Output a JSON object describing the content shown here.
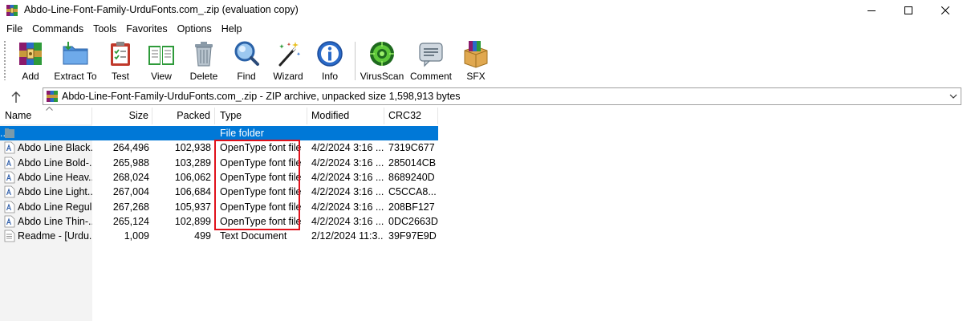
{
  "window": {
    "title": "Abdo-Line-Font-Family-UrduFonts.com_.zip (evaluation copy)"
  },
  "menu": [
    "File",
    "Commands",
    "Tools",
    "Favorites",
    "Options",
    "Help"
  ],
  "toolbar": {
    "buttons": [
      {
        "label": "Add",
        "icon": "add-archive-icon"
      },
      {
        "label": "Extract To",
        "icon": "extract-folder-icon"
      },
      {
        "label": "Test",
        "icon": "test-clipboard-icon"
      },
      {
        "label": "View",
        "icon": "view-book-icon"
      },
      {
        "label": "Delete",
        "icon": "trash-can-icon"
      },
      {
        "label": "Find",
        "icon": "magnifier-icon"
      },
      {
        "label": "Wizard",
        "icon": "magic-wand-icon"
      },
      {
        "label": "Info",
        "icon": "info-icon"
      },
      {
        "label": "VirusScan",
        "icon": "virus-scan-icon"
      },
      {
        "label": "Comment",
        "icon": "comment-icon"
      },
      {
        "label": "SFX",
        "icon": "sfx-box-icon"
      }
    ]
  },
  "address": {
    "text": "Abdo-Line-Font-Family-UrduFonts.com_.zip - ZIP archive, unpacked size 1,598,913 bytes"
  },
  "columns": {
    "name": "Name",
    "size": "Size",
    "packed": "Packed",
    "type": "Type",
    "modified": "Modified",
    "crc": "CRC32"
  },
  "files": [
    {
      "name": "..",
      "size": "",
      "packed": "",
      "type": "File folder",
      "modified": "",
      "crc": "",
      "icon": "folder-up-icon",
      "selected": true
    },
    {
      "name": "Abdo Line Black...",
      "size": "264,496",
      "packed": "102,938",
      "type": "OpenType font file",
      "modified": "4/2/2024 3:16 ...",
      "crc": "7319C677",
      "icon": "font-file-icon"
    },
    {
      "name": "Abdo Line Bold-...",
      "size": "265,988",
      "packed": "103,289",
      "type": "OpenType font file",
      "modified": "4/2/2024 3:16 ...",
      "crc": "285014CB",
      "icon": "font-file-icon"
    },
    {
      "name": "Abdo Line Heav...",
      "size": "268,024",
      "packed": "106,062",
      "type": "OpenType font file",
      "modified": "4/2/2024 3:16 ...",
      "crc": "8689240D",
      "icon": "font-file-icon"
    },
    {
      "name": "Abdo Line Light...",
      "size": "267,004",
      "packed": "106,684",
      "type": "OpenType font file",
      "modified": "4/2/2024 3:16 ...",
      "crc": "C5CCA8...",
      "icon": "font-file-icon"
    },
    {
      "name": "Abdo Line Regul...",
      "size": "267,268",
      "packed": "105,937",
      "type": "OpenType font file",
      "modified": "4/2/2024 3:16 ...",
      "crc": "208BF127",
      "icon": "font-file-icon"
    },
    {
      "name": "Abdo Line Thin-...",
      "size": "265,124",
      "packed": "102,899",
      "type": "OpenType font file",
      "modified": "4/2/2024 3:16 ...",
      "crc": "0DC2663D",
      "icon": "font-file-icon"
    },
    {
      "name": "Readme - [Urdu...",
      "size": "1,009",
      "packed": "499",
      "type": "Text Document",
      "modified": "2/12/2024 11:3...",
      "crc": "39F97E9D",
      "icon": "text-file-icon"
    }
  ],
  "colors": {
    "selection": "#0078d7",
    "highlight_box": "#e0121b"
  }
}
